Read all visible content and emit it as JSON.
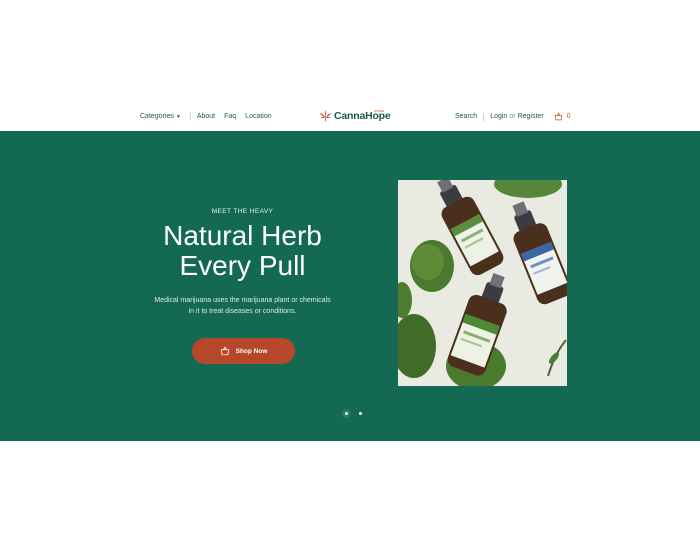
{
  "nav": {
    "categories": "Categories",
    "about": "About",
    "faq": "Faq",
    "location": "Location",
    "search": "Search",
    "login": "Login",
    "or": "or",
    "register": "Register",
    "cart_count": "0"
  },
  "logo": {
    "name": "CannaHope",
    "tagline": "STORE"
  },
  "hero": {
    "eyebrow": "MEET THE HEAVY",
    "headline_line1": "Natural Herb",
    "headline_line2": "Every Pull",
    "subtitle_line1": "Medical marijuana uses the marijuana plant or chemicals",
    "subtitle_line2": "in it to treat diseases or conditions.",
    "cta_label": "Shop Now"
  },
  "slider": {
    "slide_count": 2,
    "active_index": 0
  },
  "colors": {
    "brand_green": "#146952",
    "accent_orange": "#b5472a",
    "nav_text": "#1a5c4a"
  },
  "icons": {
    "caret": "chevron-down-icon",
    "logo_mark": "cannabis-leaf-icon",
    "cart": "shopping-basket-icon",
    "cta": "shopping-basket-icon"
  }
}
